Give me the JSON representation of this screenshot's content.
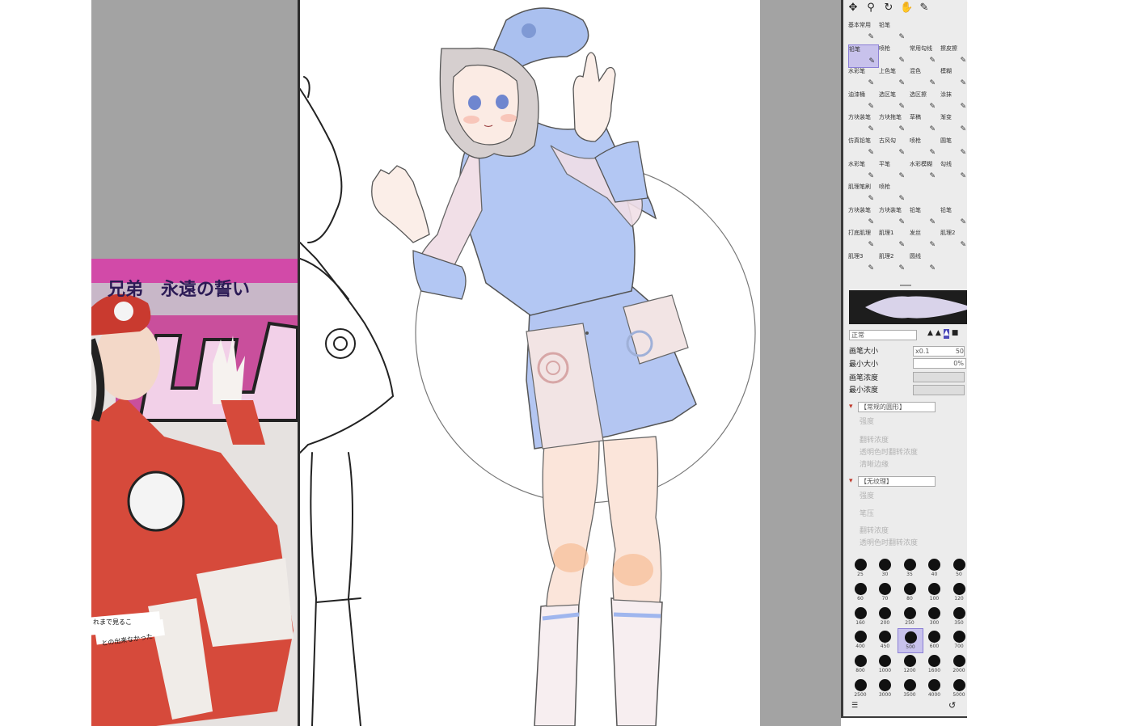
{
  "tools": [
    {
      "name": "move-icon",
      "glyph": "✥"
    },
    {
      "name": "zoom-icon",
      "glyph": "⚲"
    },
    {
      "name": "rotate-icon",
      "glyph": "↻"
    },
    {
      "name": "hand-icon",
      "glyph": "✋"
    },
    {
      "name": "eyedropper-icon",
      "glyph": "✎"
    }
  ],
  "brush_tabs": [
    "基本常用",
    "铅笔"
  ],
  "brushes": [
    "铅笔",
    "喷枪",
    "常用勾线",
    "擦皮擦",
    "水彩笔",
    "上色笔",
    "混色",
    "模糊",
    "油漆桶",
    "选区笔",
    "选区擦",
    "涂抹",
    "方块装笔",
    "方块拖笔",
    "草稿",
    "渐变",
    "仿真铅笔",
    "古风勾",
    "喷枪",
    "圆笔",
    "水彩笔",
    "平笔",
    "水彩模糊",
    "勾线",
    "肌理笔刷",
    "喷枪",
    "方块装笔",
    "方块装笔",
    "铅笔",
    "铅笔",
    "打底肌理",
    "肌理1",
    "发丝",
    "肌理2",
    "肌理3",
    "肌理2",
    "圆线"
  ],
  "blend_mode": "正常",
  "brush_size_label": "画笔大小",
  "brush_size_mult": "x0.1",
  "brush_size_value": "50",
  "min_size_label": "最小大小",
  "min_size_value": "0%",
  "density_label": "画笔浓度",
  "min_density_label": "最小浓度",
  "shape_select": "【常规的圆形】",
  "shape_strength": "强度",
  "shape_options": [
    "翻转浓度",
    "透明色时翻转浓度",
    "清晰边缘"
  ],
  "texture_select": "【无纹理】",
  "texture_strength": "强度",
  "texture_pressure": "笔压",
  "texture_options": [
    "翻转浓度",
    "透明色时翻转浓度"
  ],
  "size_presets": [
    "25",
    "30",
    "35",
    "40",
    "50",
    "60",
    "70",
    "80",
    "100",
    "120",
    "160",
    "200",
    "250",
    "300",
    "350",
    "400",
    "450",
    "500",
    "600",
    "700",
    "800",
    "1000",
    "1200",
    "1600",
    "2000",
    "2500",
    "3000",
    "3500",
    "4000",
    "5000"
  ],
  "selected_size": "500",
  "photo_caption_1": "兄弟　永遠の誓い",
  "photo_caption_2": "れまで見るこ",
  "photo_caption_3": "との出来なかった",
  "colors": {
    "panel_bg": "#ececec",
    "selection": "#c8c2ec",
    "outfit_blue": "#a9bff0",
    "outfit_red": "#d64a3b"
  }
}
